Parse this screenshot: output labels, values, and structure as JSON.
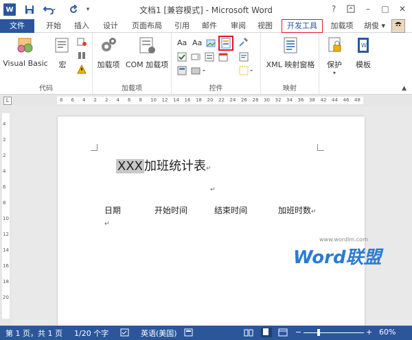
{
  "window": {
    "title": "文档1 [兼容模式] - Microsoft Word",
    "word_logo": "W",
    "help": "?",
    "minimize": "–",
    "restore": "□",
    "close": "✕"
  },
  "quick_access": {
    "save_icon": "save-icon",
    "undo_icon": "undo-icon",
    "redo_icon": "redo-icon",
    "customize_icon": "customize-icon"
  },
  "tabs": [
    "文件",
    "开始",
    "插入",
    "设计",
    "页面布局",
    "引用",
    "邮件",
    "审阅",
    "视图",
    "开发工具",
    "加载项"
  ],
  "user": {
    "name": "胡俊",
    "caret": "▾"
  },
  "ribbon": {
    "groups": [
      {
        "label": "代码",
        "buttons": [
          "Visual Basic",
          "宏"
        ]
      },
      {
        "label": "加载项",
        "buttons": [
          "加载项",
          "COM 加载项"
        ]
      },
      {
        "label": "控件",
        "buttons": []
      },
      {
        "label": "映射",
        "buttons": [
          "XML 映射窗格"
        ]
      },
      {
        "label": "",
        "buttons": [
          "保护",
          "模板"
        ]
      }
    ],
    "small_labels": {
      "aa1": "Aa",
      "aa2": "Aa"
    }
  },
  "ruler": {
    "corner": "L",
    "h_ticks": [
      "8",
      "6",
      "4",
      "2",
      "2",
      "4",
      "6",
      "8",
      "10",
      "12",
      "14",
      "16",
      "18",
      "20",
      "22",
      "24",
      "26",
      "28",
      "30",
      "32",
      "34",
      "36",
      "38",
      "42",
      "44",
      "46",
      "48"
    ],
    "v_ticks": [
      "4",
      "2",
      "2",
      "4",
      "6",
      "8",
      "10",
      "12",
      "14",
      "16",
      "18",
      "20"
    ]
  },
  "document": {
    "title_highlight": "XXX",
    "title_rest": "加班统计表",
    "para_mark": "↵",
    "columns": [
      "日期",
      "开始时间",
      "结束时间",
      "加班时数"
    ]
  },
  "watermark": {
    "brand": "Word联盟",
    "url": "www.wordlm.com"
  },
  "status": {
    "page": "第 1 页，共 1 页",
    "words": "1/20 个字",
    "lang": "英语(美国)",
    "zoom": "60%",
    "zoom_minus": "−",
    "zoom_plus": "+"
  },
  "colors": {
    "accent": "#2b579a",
    "highlight": "#c8c8c8",
    "dev_tab_border": "#e81123"
  }
}
